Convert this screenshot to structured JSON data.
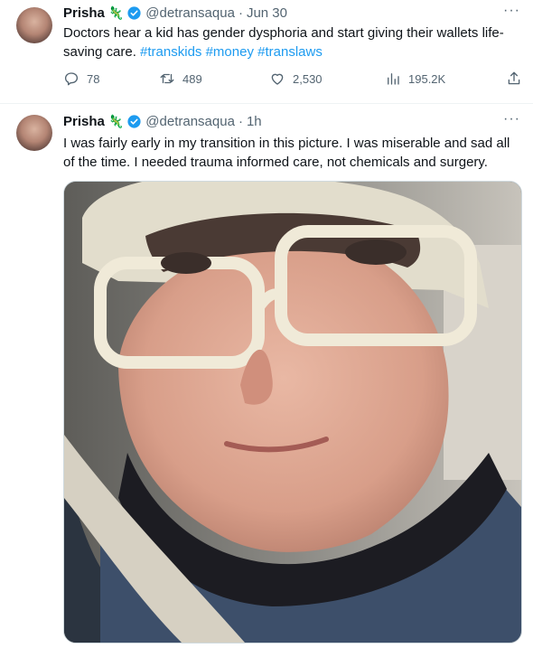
{
  "tweets": [
    {
      "author_name": "Prisha",
      "badge_emoji": "🦎",
      "handle": "@detransaqua",
      "time": "Jun 30",
      "text": "Doctors hear a kid has gender dysphoria and start giving their wallets life-saving care.",
      "hashtags": [
        "#transkids",
        "#money",
        "#translaws"
      ],
      "stats": {
        "replies": "78",
        "retweets": "489",
        "likes": "2,530",
        "views": "195.2K"
      },
      "more_label": "···"
    },
    {
      "author_name": "Prisha",
      "badge_emoji": "🦎",
      "handle": "@detransaqua",
      "time": "1h",
      "text": "I was fairly early in my transition in this picture. I was miserable and sad all of the time. I needed trauma informed care, not chemicals and surgery.",
      "more_label": "···"
    }
  ],
  "separator": "·",
  "icons": {
    "reply": "reply-icon",
    "retweet": "retweet-icon",
    "like": "heart-icon",
    "views": "views-chart-icon",
    "share": "share-icon",
    "verified": "verified-badge-icon"
  },
  "colors": {
    "accent": "#1d9bf0",
    "secondary_text": "#536471",
    "verified": "#1d9bf0"
  }
}
